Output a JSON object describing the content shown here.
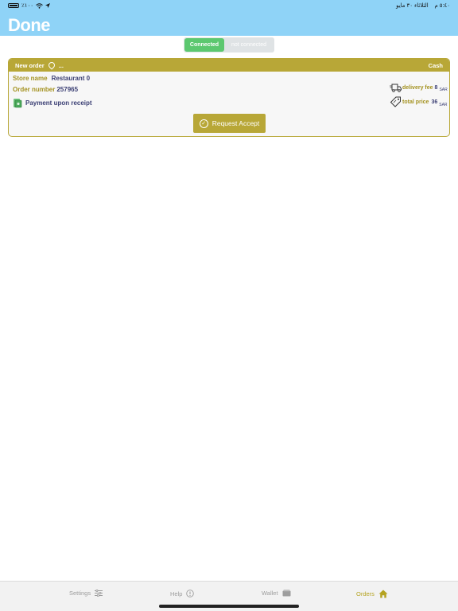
{
  "status_bar": {
    "time": "٥:٤٠ م",
    "date": "الثلاثاء ٣٠ مايو",
    "battery": "٪١٠٠"
  },
  "app": {
    "logo": "Done"
  },
  "connection": {
    "connected_label": "Connected",
    "not_connected_label": "not connected",
    "selected": "Connected"
  },
  "order": {
    "header_label": "New order",
    "header_extra": "...",
    "payment_type": "Cash",
    "store_label": "Store name",
    "store_value": "Restaurant 0",
    "order_label": "Order number",
    "order_value": "257965",
    "payment_method": "Payment upon receipt",
    "delivery_fee_label": "delivery fee",
    "delivery_fee_value": "8",
    "delivery_fee_currency": "SAR",
    "total_label": "total price",
    "total_value": "36",
    "total_currency": "SAR",
    "accept_label": "Request Accept"
  },
  "tabs": [
    {
      "label": "Settings",
      "icon": "sliders-icon"
    },
    {
      "label": "Help",
      "icon": "info-icon"
    },
    {
      "label": "Wallet",
      "icon": "wallet-icon"
    },
    {
      "label": "Orders",
      "icon": "home-icon",
      "active": true
    }
  ],
  "colors": {
    "header": "#8fd3f7",
    "accent": "#b8a737",
    "connected": "#5cc86f",
    "navy": "#3b3f74"
  }
}
